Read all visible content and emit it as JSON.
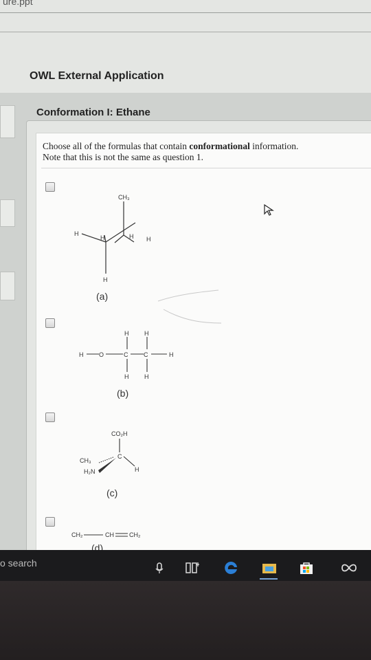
{
  "window": {
    "filename": "ure.ppt",
    "app_title": "OWL External Application"
  },
  "assignment": {
    "title": "Conformation I: Ethane"
  },
  "question": {
    "line1_a": "Choose all of the formulas that contain ",
    "line1_bold": "conformational",
    "line1_b": " information.",
    "line2": "Note that this is not the same as question 1."
  },
  "options": [
    {
      "label": "(a)",
      "atoms": {
        "top": "CH₃",
        "left": "H",
        "h1": "H",
        "h2": "H",
        "right": "H",
        "bottom": "H"
      }
    },
    {
      "label": "(b)",
      "atoms": {
        "h": "H",
        "o": "O",
        "c": "C"
      }
    },
    {
      "label": "(c)",
      "atoms": {
        "acid": "CO₂H",
        "c": "C",
        "methyl": "CH₃",
        "amine": "H₂N",
        "h": "H"
      }
    },
    {
      "label": "(d)",
      "formula_left": "CH₂",
      "formula_mid": "CH",
      "formula_right": "CH₂"
    }
  ],
  "taskbar": {
    "search_text": "o search",
    "icons": [
      "microphone-icon",
      "task-view-icon",
      "edge-icon",
      "file-explorer-icon",
      "store-icon",
      "infinity-app-icon"
    ]
  }
}
